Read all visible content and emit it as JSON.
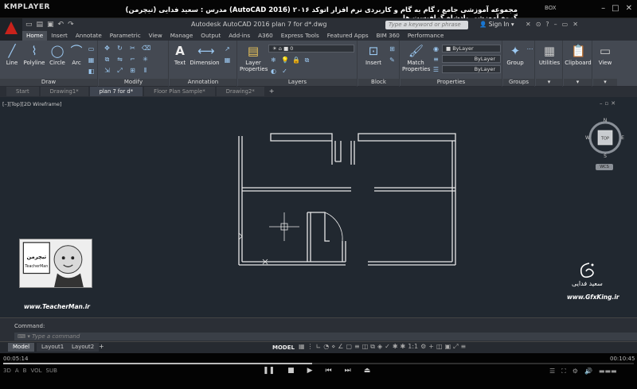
{
  "player": {
    "logo": "KMPLAYER",
    "title": "مجموعه آموزشی جامع ، گام به گام و کاربردی نرم افزار  اتوکد ۲۰۱۶ (AutoCAD 2016)   مدرس : سعید فدایی (تیچرمن) گروه آموزشی پادشاه گرافیست ها",
    "codec": "BOX",
    "time_current": "00:05:14",
    "time_total": "00:10:45",
    "progress": 0.49,
    "left_labels": [
      "A",
      "B",
      "VOL",
      "SUB"
    ],
    "window_buttons": [
      "–",
      "□",
      "✕"
    ]
  },
  "autocad": {
    "window_title": "Autodesk AutoCAD 2016   plan 7 for d*.dwg",
    "search_placeholder": "Type a keyword or phrase",
    "sign_in": "Sign In",
    "ribbon_tabs": [
      "Home",
      "Insert",
      "Annotate",
      "Parametric",
      "View",
      "Manage",
      "Output",
      "Add-ins",
      "A360",
      "Express Tools",
      "Featured Apps",
      "BIM 360",
      "Performance"
    ],
    "active_tab": "Home",
    "panels": {
      "draw": {
        "label": "Draw",
        "tools": [
          "Line",
          "Polyline",
          "Circle",
          "Arc"
        ]
      },
      "modify": {
        "label": "Modify"
      },
      "annotation": {
        "label": "Annotation",
        "tools": [
          "Text",
          "Dimension"
        ]
      },
      "layers": {
        "label": "Layers",
        "tool": "Layer\nProperties",
        "layer_value": "0"
      },
      "block": {
        "label": "Block",
        "tool": "Insert"
      },
      "properties": {
        "label": "Properties",
        "tool": "Match\nProperties",
        "color": "ByLayer",
        "linetype": "ByLayer",
        "lineweight": "ByLayer"
      },
      "groups": {
        "label": "Groups",
        "tool": "Group"
      },
      "utilities": {
        "tool": "Utilities"
      },
      "clipboard": {
        "tool": "Clipboard"
      },
      "view": {
        "tool": "View"
      }
    },
    "doc_tabs": [
      "Start",
      "Drawing1*",
      "plan 7 for d*",
      "Floor Plan Sample*",
      "Drawing2*"
    ],
    "active_doc": "plan 7 for d*",
    "viewport_label": "[–][Top][2D Wireframe]",
    "viewcube": {
      "face": "TOP",
      "n": "N",
      "s": "S",
      "e": "E",
      "w": "W",
      "wcs": "WCS"
    },
    "command_label": "Command:",
    "command_placeholder": "Type a command",
    "layout_tabs": [
      "Model",
      "Layout1",
      "Layout2"
    ],
    "model_button": "MODEL",
    "scale": "1:1"
  },
  "watermark": {
    "teacher_logo": "تیچرمن",
    "teacher_sub": "TeacherMan",
    "teacher_url": "www.TeacherMan.ir",
    "gfx_name": "سعید فدایی",
    "gfx_url": "www.GfxKing.ir"
  }
}
